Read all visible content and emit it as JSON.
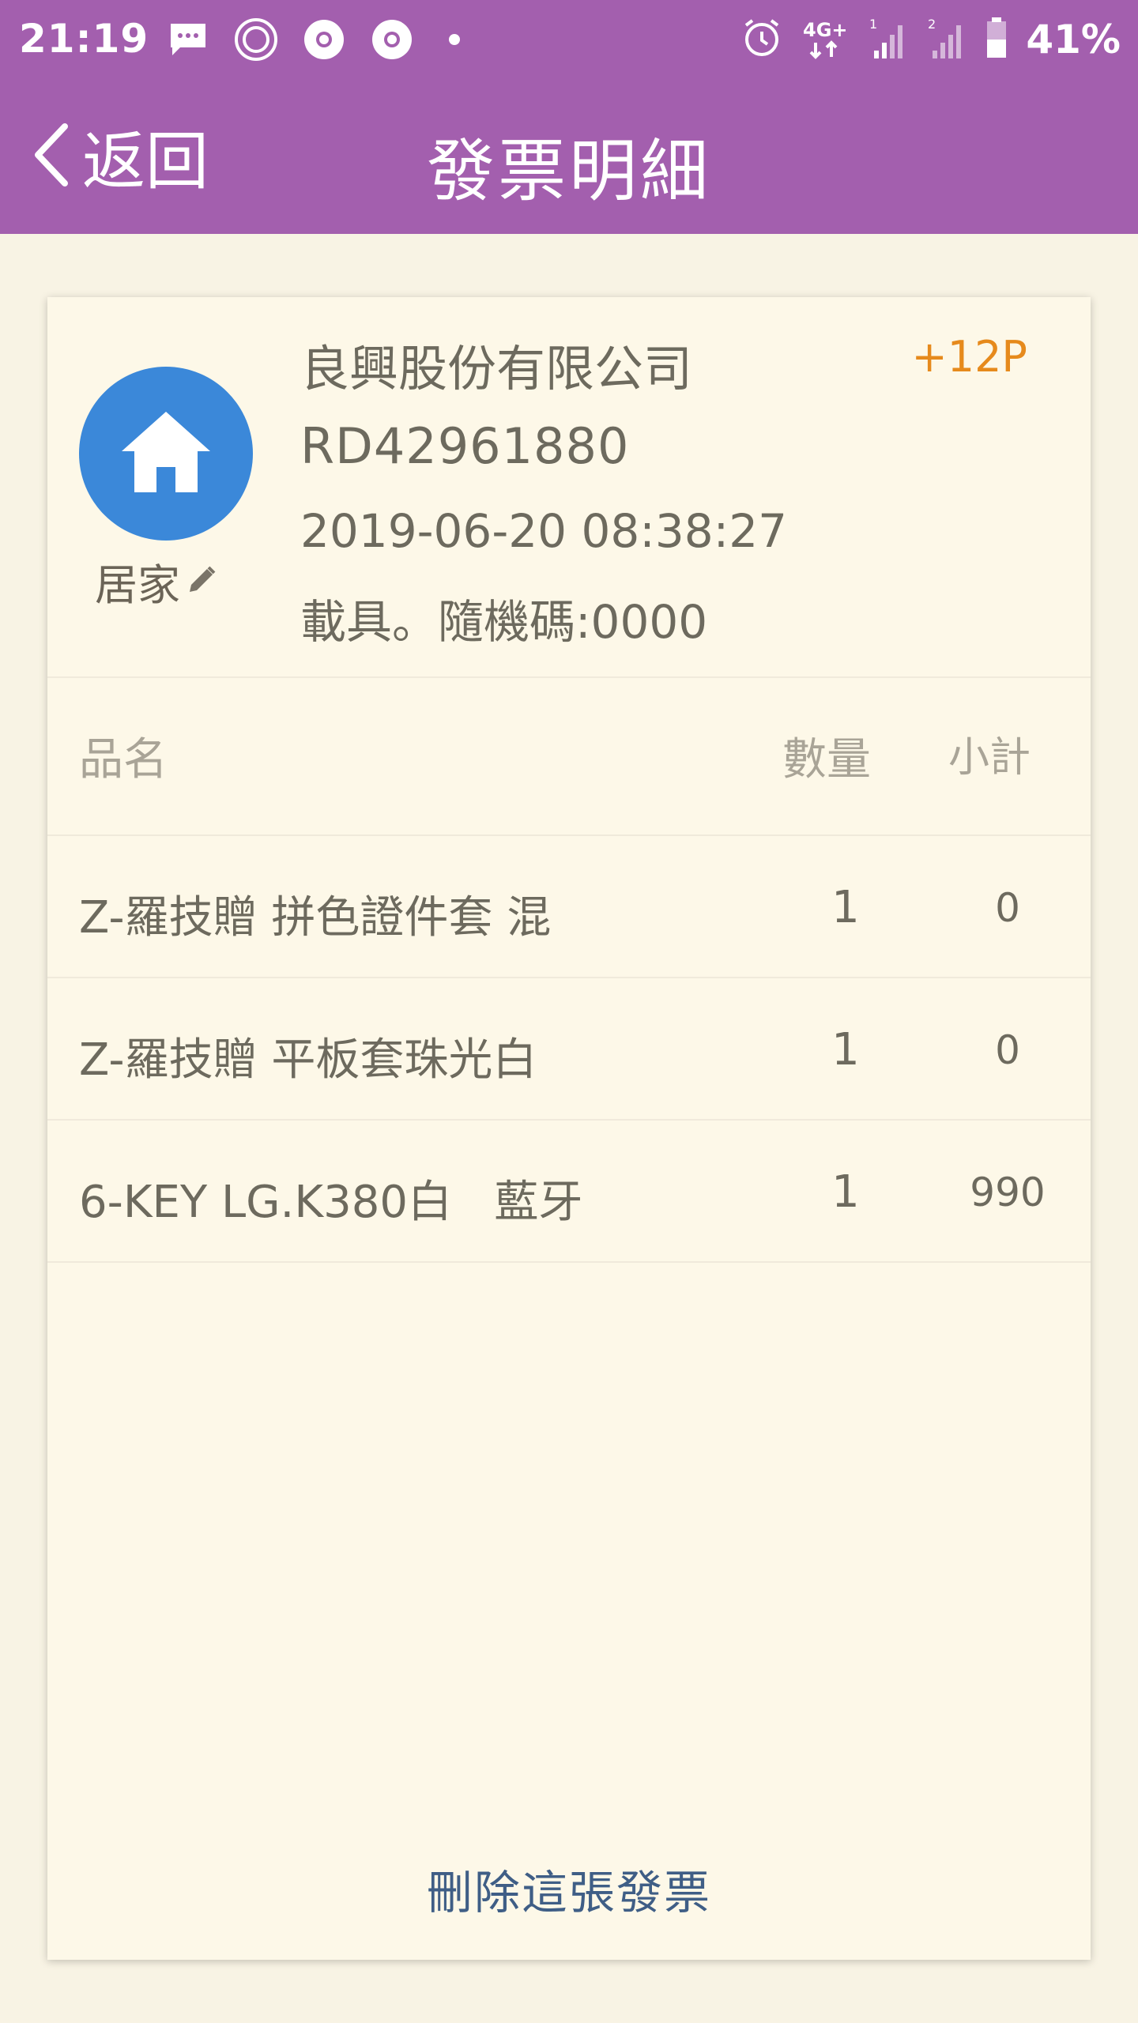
{
  "status_bar": {
    "time": "21:19",
    "battery": "41%"
  },
  "header": {
    "back_label": "返回",
    "title": "發票明細"
  },
  "invoice": {
    "category": "居家",
    "seller": "良興股份有限公司",
    "points": "+12P",
    "number": "RD42961880",
    "datetime": "2019-06-20 08:38:27",
    "carrier": "載具。隨機碼:0000"
  },
  "table": {
    "headers": {
      "name": "品名",
      "qty": "數量",
      "subtotal": "小計"
    },
    "rows": [
      {
        "name": "Z-羅技贈 拼色證件套 混",
        "qty": "1",
        "subtotal": "0"
      },
      {
        "name": "Z-羅技贈 平板套珠光白",
        "qty": "1",
        "subtotal": "0"
      },
      {
        "name": "6-KEY LG.K380白   藍牙",
        "qty": "1",
        "subtotal": "990"
      }
    ]
  },
  "delete_label": "刪除這張發票",
  "colors": {
    "header_bg": "#a35fae",
    "page_bg": "#f8f3e4",
    "card_bg": "#fdf8e8",
    "category_circle": "#3b88d9",
    "points": "#e68a1c",
    "delete_link": "#3f5e86"
  },
  "icons": [
    "message-icon",
    "browser-icon",
    "chrome-icon",
    "chrome-icon",
    "alarm-icon",
    "network-4g-icon",
    "signal-icon",
    "battery-icon",
    "back-chevron-icon",
    "home-icon",
    "pencil-icon"
  ]
}
